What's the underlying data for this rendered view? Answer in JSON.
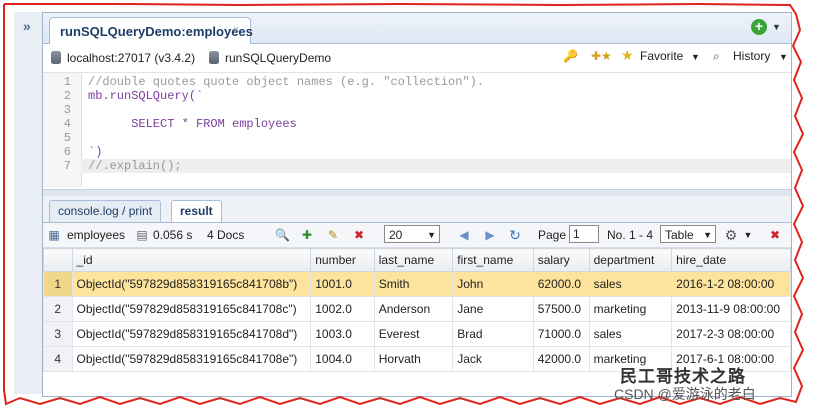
{
  "tab": {
    "title": "runSQLQueryDemo:employees",
    "close": "×"
  },
  "connection": {
    "host": "localhost:27017 (v3.4.2)",
    "database": "runSQLQueryDemo",
    "favorite_label": "Favorite",
    "history_label": "History"
  },
  "editor": {
    "lines": [
      {
        "num": "1",
        "text": "//double quotes quote object names (e.g. \"collection\")."
      },
      {
        "num": "2",
        "text": "mb.runSQLQuery(`"
      },
      {
        "num": "3",
        "text": ""
      },
      {
        "num": "4",
        "text": "      SELECT * FROM employees"
      },
      {
        "num": "5",
        "text": ""
      },
      {
        "num": "6",
        "text": "`)"
      },
      {
        "num": "7",
        "text": "//.explain();"
      }
    ]
  },
  "lower_tabs": {
    "console": "console.log / print",
    "result": "result"
  },
  "result_toolbar": {
    "collection": "employees",
    "time": "0.056 s",
    "docs": "4 Docs",
    "page_size": "20",
    "page_label": "Page",
    "page_value": "1",
    "range": "No. 1 - 4",
    "view_mode": "Table"
  },
  "grid": {
    "columns": [
      "_id",
      "number",
      "last_name",
      "first_name",
      "salary",
      "department",
      "hire_date"
    ],
    "rows": [
      {
        "n": "1",
        "cells": [
          "ObjectId(\"597829d858319165c841708b\")",
          "1001.0",
          "Smith",
          "John",
          "62000.0",
          "sales",
          "2016-1-2 08:00:00"
        ]
      },
      {
        "n": "2",
        "cells": [
          "ObjectId(\"597829d858319165c841708c\")",
          "1002.0",
          "Anderson",
          "Jane",
          "57500.0",
          "marketing",
          "2013-11-9 08:00:00"
        ]
      },
      {
        "n": "3",
        "cells": [
          "ObjectId(\"597829d858319165c841708d\")",
          "1003.0",
          "Everest",
          "Brad",
          "71000.0",
          "sales",
          "2017-2-3 08:00:00"
        ]
      },
      {
        "n": "4",
        "cells": [
          "ObjectId(\"597829d858319165c841708e\")",
          "1004.0",
          "Horvath",
          "Jack",
          "42000.0",
          "marketing",
          "2017-6-1 08:00:00"
        ]
      }
    ]
  },
  "watermark": {
    "line1": "民工哥技术之路",
    "line2": "CSDN @爱游泳的老白"
  },
  "colors": {
    "accent": "#1c3d66",
    "selected_row": "#fde39c",
    "border_red": "#e0241b",
    "add_green": "#3aa33a"
  }
}
